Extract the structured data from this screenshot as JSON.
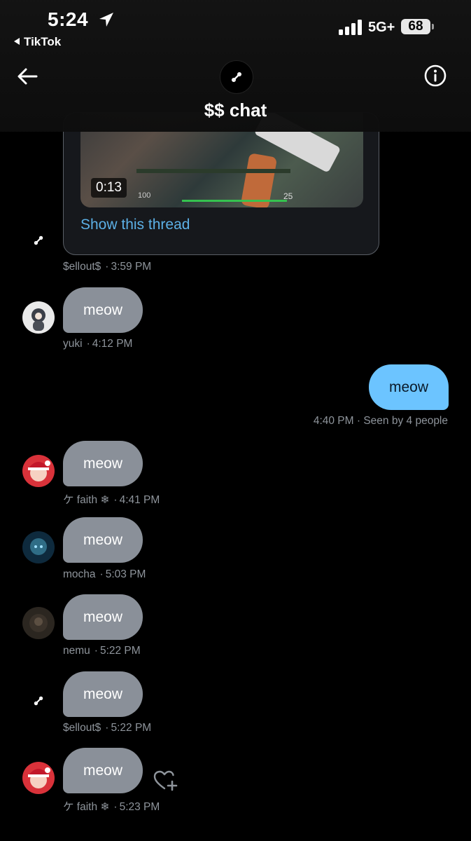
{
  "status_bar": {
    "time": "5:24",
    "back_app": "TikTok",
    "network": "5G+",
    "battery": "68"
  },
  "header": {
    "title": "$$ chat"
  },
  "thread_card": {
    "duration": "0:13",
    "show_thread": "Show this thread",
    "hud_ammo": "25",
    "hud_hp": "100"
  },
  "messages": [
    {
      "type": "in",
      "sender": "$ellout$",
      "time": "3:59 PM"
    },
    {
      "type": "in",
      "sender": "yuki",
      "time": "4:12 PM",
      "text": "meow"
    },
    {
      "type": "out",
      "time": "4:40 PM",
      "seen": "Seen by 4 people",
      "text": "meow"
    },
    {
      "type": "in",
      "sender": "ケ faith ❄",
      "time": "4:41 PM",
      "text": "meow"
    },
    {
      "type": "in",
      "sender": "mocha",
      "time": "5:03 PM",
      "text": "meow"
    },
    {
      "type": "in",
      "sender": "nemu",
      "time": "5:22 PM",
      "text": "meow"
    },
    {
      "type": "in",
      "sender": "$ellout$",
      "time": "5:22 PM",
      "text": "meow"
    },
    {
      "type": "in",
      "sender": "ケ faith ❄",
      "time": "5:23 PM",
      "text": "meow"
    }
  ],
  "icons": {
    "back": "arrow-left-icon",
    "info": "info-icon",
    "react": "heart-plus-icon"
  },
  "colors": {
    "bubble_in": "#8a9099",
    "bubble_out": "#6cc4ff",
    "link": "#5cb0e6"
  }
}
